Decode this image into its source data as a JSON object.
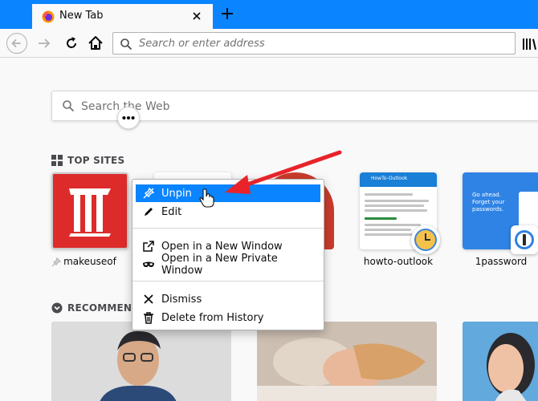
{
  "browser": {
    "tab_title": "New Tab",
    "url_placeholder": "Search or enter address",
    "icons": {
      "favicon": "firefox-icon",
      "close": "close-icon",
      "new_tab": "plus-icon",
      "back": "back-arrow-icon",
      "forward": "forward-arrow-icon",
      "reload": "reload-icon",
      "home": "home-icon",
      "search": "search-icon",
      "library": "library-icon"
    },
    "accent_color": "#0a84ff"
  },
  "newtab": {
    "search_placeholder": "Search the Web",
    "top_sites_title": "TOP SITES",
    "recommended_title": "RECOMMEND",
    "sites": [
      {
        "label": "makeuseof",
        "pinned": true
      },
      {
        "label": "howto-outlook",
        "pinned": false
      },
      {
        "label": "1password",
        "pinned": false
      }
    ],
    "howto_header": "HowTo-Outlook",
    "onepw_headline": "Go ahead. Forget your passwords."
  },
  "context_menu": {
    "items": [
      {
        "label": "Unpin",
        "icon": "unpin-icon",
        "highlighted": true
      },
      {
        "label": "Edit",
        "icon": "pencil-icon"
      },
      {
        "label": "Open in a New Window",
        "icon": "new-window-icon"
      },
      {
        "label": "Open in a New Private Window",
        "icon": "private-mask-icon"
      },
      {
        "label": "Dismiss",
        "icon": "x-icon"
      },
      {
        "label": "Delete from History",
        "icon": "trash-icon"
      }
    ]
  },
  "annotation": {
    "arrow_color": "#e8232a"
  }
}
